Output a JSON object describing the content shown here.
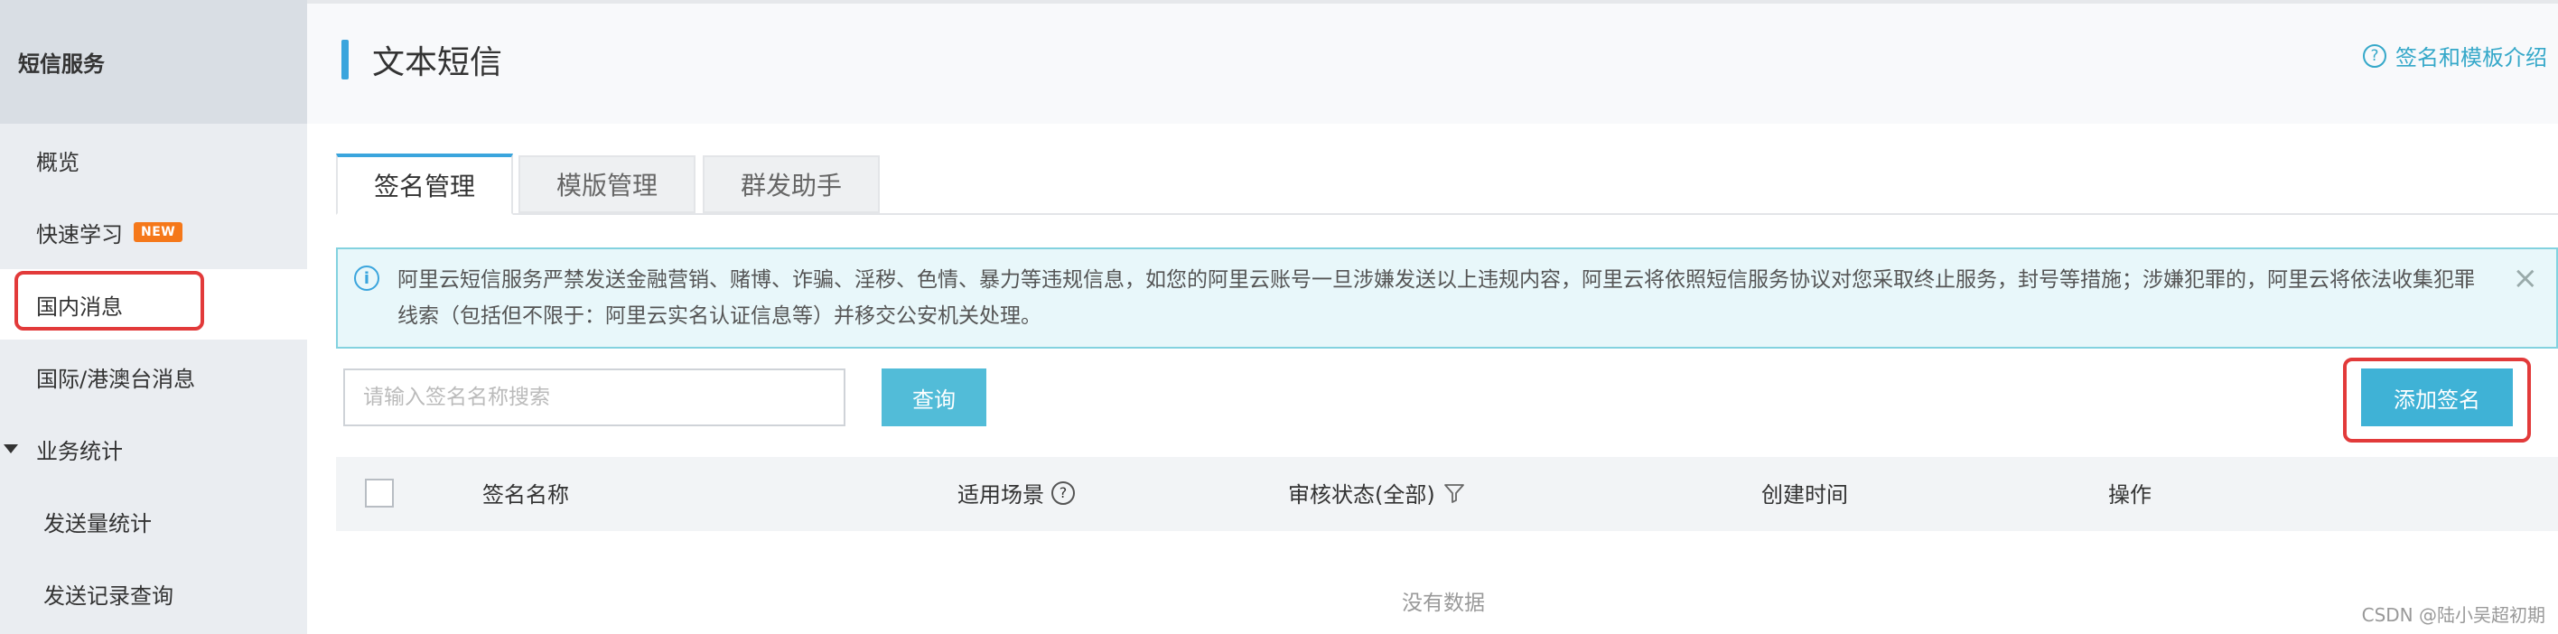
{
  "sidebar": {
    "title": "短信服务",
    "items": [
      {
        "label": "概览"
      },
      {
        "label": "快速学习",
        "badge": "NEW"
      },
      {
        "label": "国内消息"
      },
      {
        "label": "国际/港澳台消息"
      },
      {
        "label": "业务统计"
      },
      {
        "label": "发送量统计"
      },
      {
        "label": "发送记录查询"
      }
    ]
  },
  "header": {
    "title": "文本短信",
    "help_link": "签名和模板介绍"
  },
  "tabs": [
    {
      "label": "签名管理"
    },
    {
      "label": "模版管理"
    },
    {
      "label": "群发助手"
    }
  ],
  "alert": {
    "text": "阿里云短信服务严禁发送金融营销、赌博、诈骗、淫秽、色情、暴力等违规信息，如您的阿里云账号一旦涉嫌发送以上违规内容，阿里云将依照短信服务协议对您采取终止服务，封号等措施；涉嫌犯罪的，阿里云将依法收集犯罪线索（包括但不限于：阿里云实名认证信息等）并移交公安机关处理。"
  },
  "search": {
    "placeholder": "请输入签名名称搜索",
    "query_label": "查询",
    "add_label": "添加签名"
  },
  "table": {
    "columns": [
      "签名名称",
      "适用场景",
      "审核状态(全部)",
      "创建时间",
      "操作"
    ],
    "empty_text": "没有数据"
  },
  "watermark": "CSDN @陆小吴超初期",
  "colors": {
    "accent": "#3aa5dd",
    "highlight_box": "#e23a3a",
    "button": "#3fb2d6"
  }
}
